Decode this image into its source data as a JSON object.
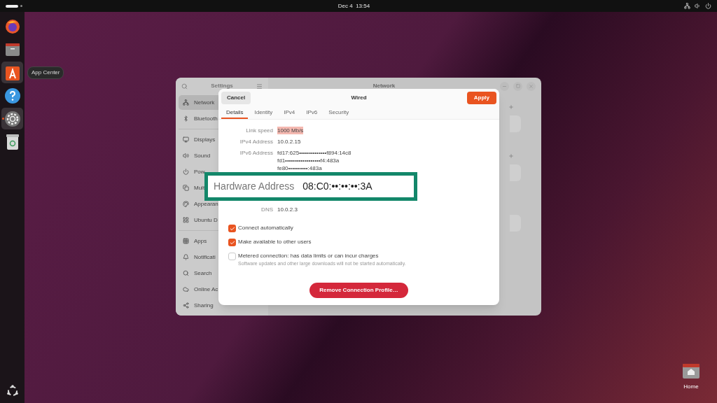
{
  "top_bar": {
    "clock": "Dec 4  13:54"
  },
  "dock": {
    "items": [
      {
        "hovered": false,
        "running": false
      },
      {
        "hovered": false,
        "running": false
      },
      {
        "hovered": true,
        "running": false
      },
      {
        "hovered": false,
        "running": false
      },
      {
        "hovered": false,
        "running": true
      },
      {
        "hovered": false,
        "running": false
      }
    ],
    "tooltip": "App Center"
  },
  "settings_window": {
    "sidebar_title": "Settings",
    "panel_title": "Network",
    "sidebar": {
      "items": [
        {
          "label": "Network",
          "selected": true
        },
        {
          "label": "Bluetooth",
          "selected": false
        },
        {
          "label": "Displays",
          "selected": false
        },
        {
          "label": "Sound",
          "selected": false
        },
        {
          "label": "Pow",
          "selected": false
        },
        {
          "label": "Mult",
          "selected": false
        },
        {
          "label": "Appearan",
          "selected": false
        },
        {
          "label": "Ubuntu D",
          "selected": false
        },
        {
          "label": "Apps",
          "selected": false
        },
        {
          "label": "Notificati",
          "selected": false
        },
        {
          "label": "Search",
          "selected": false
        },
        {
          "label": "Online Ac",
          "selected": false
        },
        {
          "label": "Sharing",
          "selected": false
        }
      ]
    }
  },
  "dialog": {
    "title": "Wired",
    "cancel": "Cancel",
    "apply": "Apply",
    "tabs": [
      {
        "label": "Details",
        "selected": true
      },
      {
        "label": "Identity",
        "selected": false
      },
      {
        "label": "IPv4",
        "selected": false
      },
      {
        "label": "IPv6",
        "selected": false
      },
      {
        "label": "Security",
        "selected": false
      }
    ],
    "details": [
      {
        "label": "Link speed",
        "values": [
          "1000 Mb/s"
        ],
        "highlighted": true
      },
      {
        "label": "IPv4 Address",
        "values": [
          "10.0.2.15"
        ],
        "highlighted": false
      },
      {
        "label": "IPv6 Address",
        "values": [
          "fd17:625••••••••••••••f894:14c8",
          "fd1••••••••••••••••••f4:483a",
          "fe80••••••••••:483a"
        ],
        "highlighted": false
      },
      {
        "label": "DNS",
        "values": [
          "10.0.2.3"
        ],
        "highlighted": false
      }
    ],
    "options": [
      {
        "label": "Connect automatically",
        "checked": true
      },
      {
        "label": "Make available to other users",
        "checked": true
      },
      {
        "label": "Metered connection: has data limits or can incur charges",
        "hint": "Software updates and other large downloads will not be started automatically.",
        "checked": false
      }
    ],
    "remove": "Remove Connection Profile…"
  },
  "callout": {
    "label": "Hardware Address",
    "value": "08:C0:••:••:••:3A"
  },
  "desktop": {
    "icons": [
      {
        "label": "Home"
      }
    ]
  }
}
